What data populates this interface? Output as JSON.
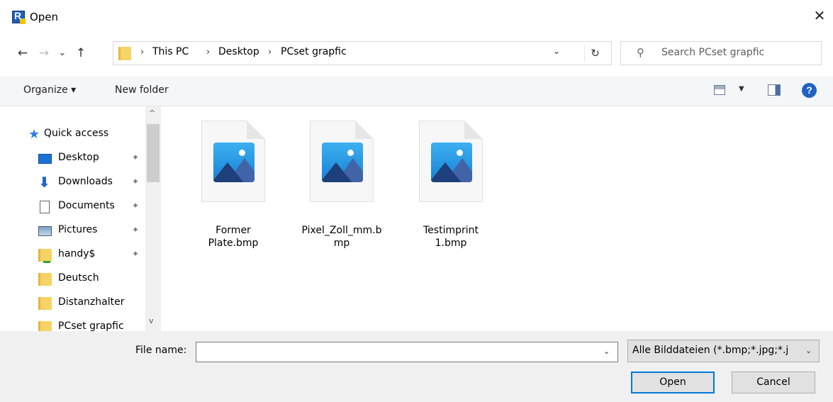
{
  "window": {
    "title": "Open",
    "close_symbol": "✕"
  },
  "nav": {
    "back_symbol": "←",
    "forward_symbol": "→",
    "recent_symbol": "⌄",
    "up_symbol": "↑"
  },
  "address": {
    "breadcrumbs": [
      "This PC",
      "Desktop",
      "PCset grapfic"
    ],
    "separator": "›",
    "dropdown_symbol": "⌄",
    "refresh_symbol": "↻"
  },
  "search": {
    "placeholder": "Search PCset grapfic",
    "icon_symbol": "⚲"
  },
  "toolbar": {
    "organize_label": "Organize ▾",
    "new_folder_label": "New folder",
    "help_label": "?"
  },
  "sidebar": {
    "items": [
      {
        "label": "Quick access",
        "icon": "star-icon",
        "pinned": false
      },
      {
        "label": "Desktop",
        "icon": "desktop-icon",
        "pinned": true
      },
      {
        "label": "Downloads",
        "icon": "download-icon",
        "pinned": true
      },
      {
        "label": "Documents",
        "icon": "document-icon",
        "pinned": true
      },
      {
        "label": "Pictures",
        "icon": "pictures-icon",
        "pinned": true
      },
      {
        "label": "handy$",
        "icon": "network-folder-icon",
        "pinned": true
      },
      {
        "label": "Deutsch",
        "icon": "folder-icon",
        "pinned": false
      },
      {
        "label": "Distanzhalter",
        "icon": "folder-icon",
        "pinned": false
      },
      {
        "label": "PCset grapfic",
        "icon": "folder-icon",
        "pinned": false
      }
    ],
    "pin_symbol": "✦",
    "scroll_up_symbol": "^",
    "scroll_down_symbol": "v"
  },
  "files": [
    {
      "name_line1": "Former",
      "name_line2": "Plate.bmp"
    },
    {
      "name_line1": "Pixel_Zoll_mm.b",
      "name_line2": "mp"
    },
    {
      "name_line1": "Testimprint",
      "name_line2": "1.bmp"
    }
  ],
  "bottom": {
    "file_name_label": "File name:",
    "file_name_value": "",
    "file_type_value": "Alle Bilddateien (*.bmp;*.jpg;*.j",
    "dropdown_symbol": "⌄",
    "open_label": "Open",
    "cancel_label": "Cancel"
  },
  "colors": {
    "accent": "#0078d7",
    "help_blue": "#1f62c5",
    "folder_yellow": "#f6d365"
  }
}
